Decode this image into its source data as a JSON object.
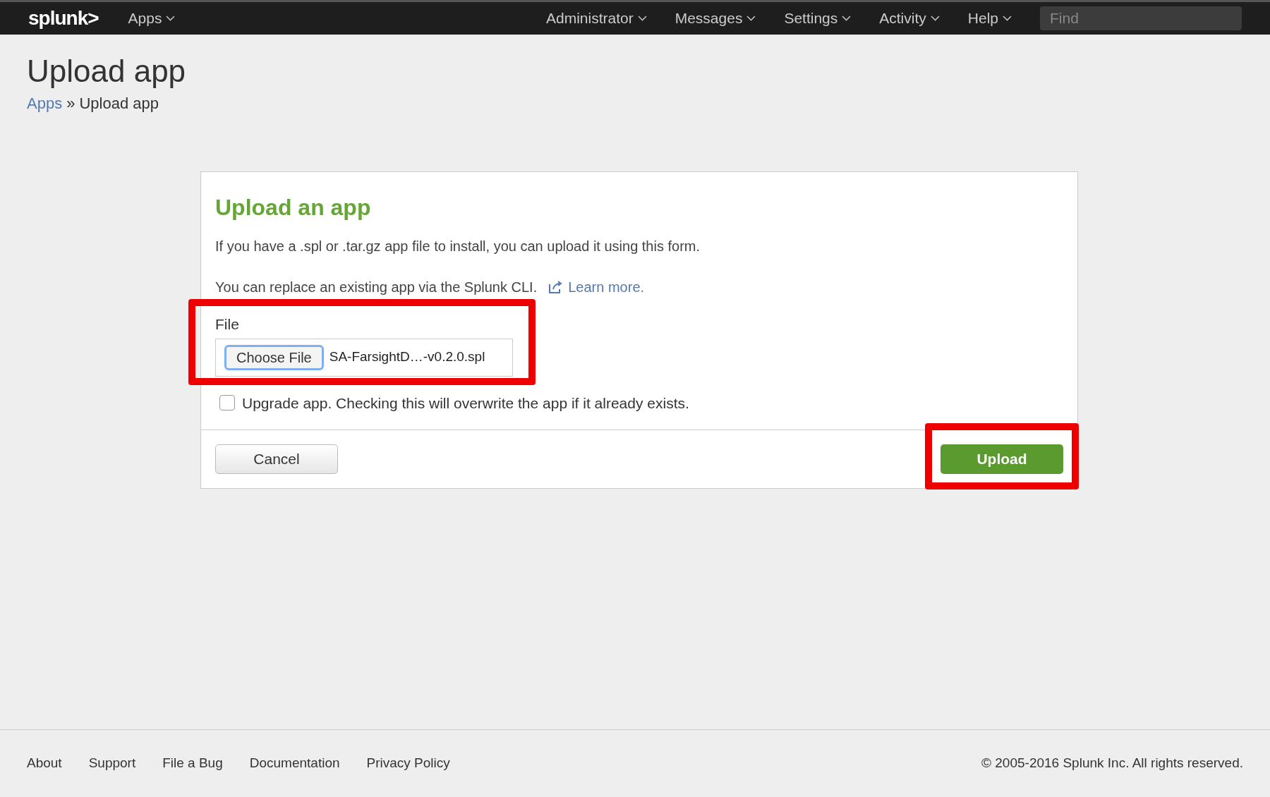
{
  "nav": {
    "logo": "splunk>",
    "apps_menu": "Apps",
    "menus": [
      "Administrator",
      "Messages",
      "Settings",
      "Activity",
      "Help"
    ],
    "search": {
      "placeholder": "Find"
    }
  },
  "page": {
    "title": "Upload app",
    "breadcrumb": [
      {
        "label": "Apps",
        "kind": "link"
      },
      {
        "label": "»",
        "kind": "separator"
      },
      {
        "label": "Upload app",
        "kind": "current"
      }
    ]
  },
  "card": {
    "heading": "Upload an app",
    "intro": "If you have a .spl or .tar.gz app file to install, you can upload it using this form.",
    "cli_note": "You can replace an existing app via the Splunk CLI.",
    "learn_more": "Learn more.",
    "file_field": {
      "label": "File",
      "button": "Choose File",
      "value": "SA-FarsightD…-v0.2.0.spl"
    },
    "upgrade": {
      "label": "Upgrade app. Checking this will overwrite the app if it already exists.",
      "checked": false
    },
    "buttons": [
      {
        "label": "Cancel",
        "kind": "secondary"
      },
      {
        "label": "Upload",
        "kind": "primary"
      }
    ]
  },
  "footer": {
    "links": [
      "About",
      "Support",
      "File a Bug",
      "Documentation",
      "Privacy Policy"
    ],
    "copyright": "© 2005-2016 Splunk Inc. All rights reserved."
  }
}
